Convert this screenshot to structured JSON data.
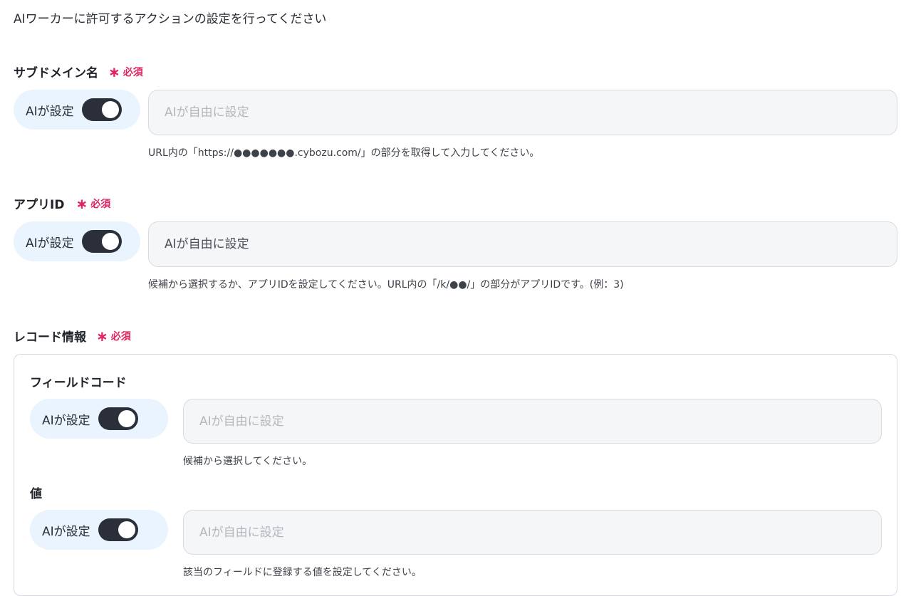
{
  "intro": "AIワーカーに許可するアクションの設定を行ってください",
  "required_label": "必須",
  "required_mark": "∗",
  "toggle_label": "AIが設定",
  "fields": [
    {
      "label": "サブドメイン名",
      "placeholder": "AIが自由に設定",
      "help": "URL内の「https://●●●●●●●.cybozu.com/」の部分を取得して入力してください。",
      "toggle_on": true
    },
    {
      "label": "アプリID",
      "placeholder": "AIが自由に設定",
      "help": "候補から選択するか、アプリIDを設定してください。URL内の「/k/●●/」の部分がアプリIDです。(例：3)",
      "toggle_on": true
    }
  ],
  "record": {
    "label": "レコード情報",
    "subfields": [
      {
        "label": "フィールドコード",
        "placeholder": "AIが自由に設定",
        "help": "候補から選択してください。",
        "toggle_on": true
      },
      {
        "label": "値",
        "placeholder": "AIが自由に設定",
        "help": "該当のフィールドに登録する値を設定してください。",
        "toggle_on": true
      }
    ]
  },
  "colors": {
    "required": "#e0245e",
    "pill_bg": "#eaf4ff",
    "toggle_on": "#2a2f3a",
    "field_bg": "#f4f6f8"
  }
}
